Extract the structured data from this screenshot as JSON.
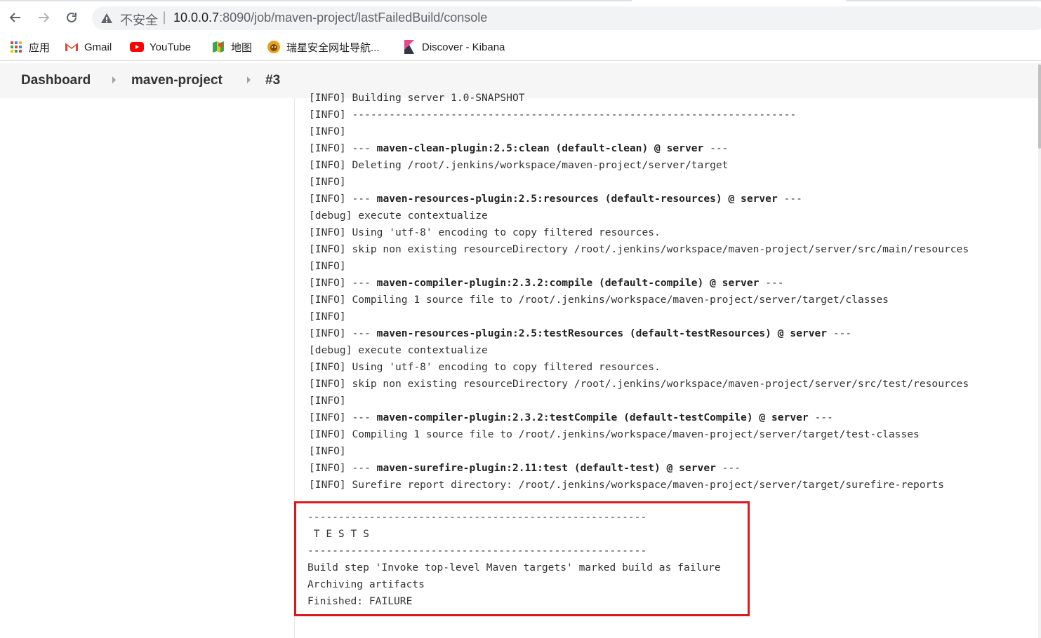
{
  "browser": {
    "security_label": "不安全",
    "separator": "|",
    "url_host": "10.0.0.7",
    "url_rest": ":8090/job/maven-project/lastFailedBuild/console"
  },
  "bookmarks": [
    {
      "label": "应用",
      "icon": "apps-grid-icon"
    },
    {
      "label": "Gmail",
      "icon": "gmail-icon"
    },
    {
      "label": "YouTube",
      "icon": "youtube-icon"
    },
    {
      "label": "地图",
      "icon": "maps-icon"
    },
    {
      "label": "瑞星安全网址导航...",
      "icon": "rising-lion-icon"
    },
    {
      "label": "Discover - Kibana",
      "icon": "kibana-icon"
    }
  ],
  "breadcrumb": {
    "items": [
      "Dashboard",
      "maven-project",
      "#3"
    ]
  },
  "console": {
    "lines": [
      "[INFO] Building server 1.0-SNAPSHOT",
      "[INFO] ------------------------------------------------------------------------",
      "[INFO]",
      "[INFO] --- maven-clean-plugin:2.5:clean (default-clean) @ server ---",
      "[INFO] Deleting /root/.jenkins/workspace/maven-project/server/target",
      "[INFO]",
      "[INFO] --- maven-resources-plugin:2.5:resources (default-resources) @ server ---",
      "[debug] execute contextualize",
      "[INFO] Using 'utf-8' encoding to copy filtered resources.",
      "[INFO] skip non existing resourceDirectory /root/.jenkins/workspace/maven-project/server/src/main/resources",
      "[INFO]",
      "[INFO] --- maven-compiler-plugin:2.3.2:compile (default-compile) @ server ---",
      "[INFO] Compiling 1 source file to /root/.jenkins/workspace/maven-project/server/target/classes",
      "[INFO]",
      "[INFO] --- maven-resources-plugin:2.5:testResources (default-testResources) @ server ---",
      "[debug] execute contextualize",
      "[INFO] Using 'utf-8' encoding to copy filtered resources.",
      "[INFO] skip non existing resourceDirectory /root/.jenkins/workspace/maven-project/server/src/test/resources",
      "[INFO]",
      "[INFO] --- maven-compiler-plugin:2.3.2:testCompile (default-testCompile) @ server ---",
      "[INFO] Compiling 1 source file to /root/.jenkins/workspace/maven-project/server/target/test-classes",
      "[INFO]",
      "[INFO] --- maven-surefire-plugin:2.11:test (default-test) @ server ---",
      "[INFO] Surefire report directory: /root/.jenkins/workspace/maven-project/server/target/surefire-reports"
    ],
    "tail_lines": [
      "-------------------------------------------------------",
      " T E S T S",
      "-------------------------------------------------------",
      "Build step 'Invoke top-level Maven targets' marked build as failure",
      "Archiving artifacts",
      "Finished: FAILURE"
    ]
  },
  "colors": {
    "highlight_border": "#d9191d",
    "breadcrumb_bg": "#f6f6f6"
  }
}
